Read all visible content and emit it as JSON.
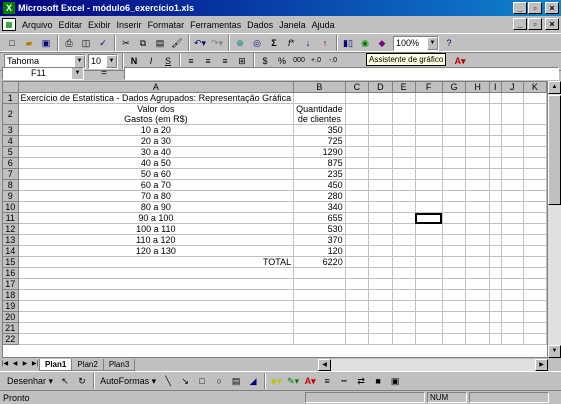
{
  "window": {
    "title": "Microsoft Excel - módulo6_exercício1.xls",
    "app_icon": "excel-icon",
    "min": "_",
    "max": "▫",
    "close": "×"
  },
  "menu": [
    "Arquivo",
    "Editar",
    "Exibir",
    "Inserir",
    "Formatar",
    "Ferramentas",
    "Dados",
    "Janela",
    "Ajuda"
  ],
  "standard_toolbar": {
    "zoom": "100%",
    "sum": "Σ",
    "fx": "f*"
  },
  "format_toolbar": {
    "font": "Tahoma",
    "size": "10",
    "bold": "N",
    "italic": "I",
    "underline": "S",
    "percent": "%",
    "thousands": "000"
  },
  "tooltip": "Assistente de gráfico",
  "formula_bar": {
    "name_box": "F11",
    "equals": "=",
    "content": ""
  },
  "columns": [
    "A",
    "B",
    "C",
    "D",
    "E",
    "F",
    "G",
    "H",
    "I",
    "J",
    "K"
  ],
  "rows": [
    {
      "n": "1",
      "a": "Exercício de Estatística - Dados Agrupados: Representação Gráfica",
      "b": ""
    },
    {
      "n": "2",
      "a": "Valor dos\nGastos (em R$)",
      "b": "Quantidade\nde clientes"
    },
    {
      "n": "3",
      "a": "10 a 20",
      "b": "350"
    },
    {
      "n": "4",
      "a": "20 a 30",
      "b": "725"
    },
    {
      "n": "5",
      "a": "30 a 40",
      "b": "1290"
    },
    {
      "n": "6",
      "a": "40 a 50",
      "b": "875"
    },
    {
      "n": "7",
      "a": "50 a 60",
      "b": "235"
    },
    {
      "n": "8",
      "a": "60 a 70",
      "b": "450"
    },
    {
      "n": "9",
      "a": "70 a 80",
      "b": "280"
    },
    {
      "n": "10",
      "a": "80 a 90",
      "b": "340"
    },
    {
      "n": "11",
      "a": "90 a 100",
      "b": "655"
    },
    {
      "n": "12",
      "a": "100 a 110",
      "b": "530"
    },
    {
      "n": "13",
      "a": "110 a 120",
      "b": "370"
    },
    {
      "n": "14",
      "a": "120 a 130",
      "b": "120"
    },
    {
      "n": "15",
      "a": "TOTAL",
      "b": "6220"
    },
    {
      "n": "16",
      "a": "",
      "b": ""
    },
    {
      "n": "17",
      "a": "",
      "b": ""
    },
    {
      "n": "18",
      "a": "",
      "b": ""
    },
    {
      "n": "19",
      "a": "",
      "b": ""
    },
    {
      "n": "20",
      "a": "",
      "b": ""
    },
    {
      "n": "21",
      "a": "",
      "b": ""
    },
    {
      "n": "22",
      "a": "",
      "b": ""
    }
  ],
  "sheets": [
    "Plan1",
    "Plan2",
    "Plan3"
  ],
  "draw_toolbar": {
    "draw": "Desenhar",
    "autoshapes": "AutoFormas"
  },
  "status": {
    "text": "Pronto",
    "num": "NUM"
  }
}
